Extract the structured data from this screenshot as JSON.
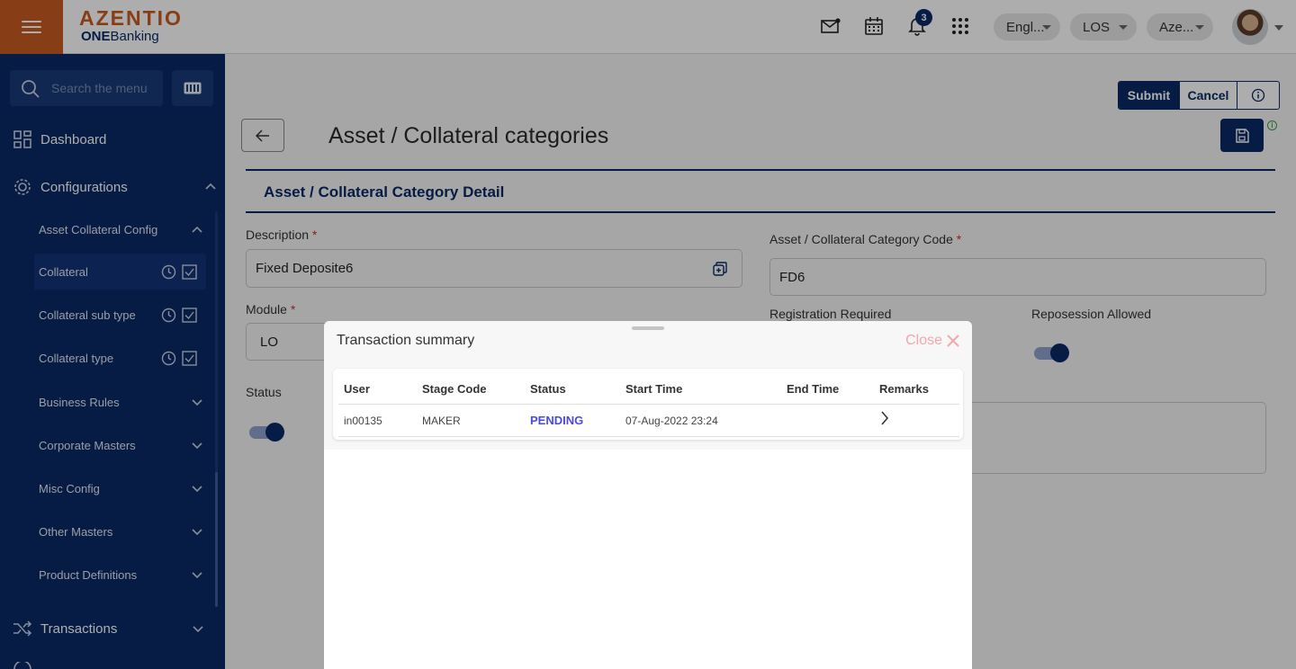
{
  "brand": {
    "main": "AZENTIO",
    "sub_bold": "ONE",
    "sub_rest": "Banking"
  },
  "header": {
    "notification_count": "3",
    "language": "Engl...",
    "app": "LOS",
    "company": "Aze..."
  },
  "sidebar": {
    "search_placeholder": "Search the menu",
    "dashboard": "Dashboard",
    "configurations": "Configurations",
    "asset_collateral_config": "Asset Collateral Config",
    "items": [
      {
        "label": "Collateral"
      },
      {
        "label": "Collateral sub type"
      },
      {
        "label": "Collateral type"
      }
    ],
    "groups": [
      {
        "label": "Business Rules"
      },
      {
        "label": "Corporate Masters"
      },
      {
        "label": "Misc Config"
      },
      {
        "label": "Other Masters"
      },
      {
        "label": "Product Definitions"
      }
    ],
    "transactions": "Transactions"
  },
  "page": {
    "title": "Asset / Collateral categories",
    "submit": "Submit",
    "cancel": "Cancel",
    "section_title": "Asset / Collateral Category Detail",
    "description_label": "Description",
    "description_value": "Fixed Deposite6",
    "code_label": "Asset / Collateral Category Code",
    "code_value": "FD6",
    "module_label": "Module",
    "module_value": "LO",
    "registration_label": "Registration Required",
    "reposession_label": "Reposession Allowed",
    "status_label": "Status",
    "required_mark": "*"
  },
  "modal": {
    "title": "Transaction summary",
    "close": "Close",
    "columns": [
      "User",
      "Stage Code",
      "Status",
      "Start Time",
      "End Time",
      "Remarks"
    ],
    "rows": [
      {
        "user": "in00135",
        "stage_code": "MAKER",
        "status": "PENDING",
        "start_time": "07-Aug-2022 23:24",
        "end_time": ""
      }
    ]
  },
  "colors": {
    "brand_navy": "#0a2a66",
    "brand_orange": "#c75b1f",
    "pending": "#4a4ae0",
    "close": "#f3a6ae"
  }
}
